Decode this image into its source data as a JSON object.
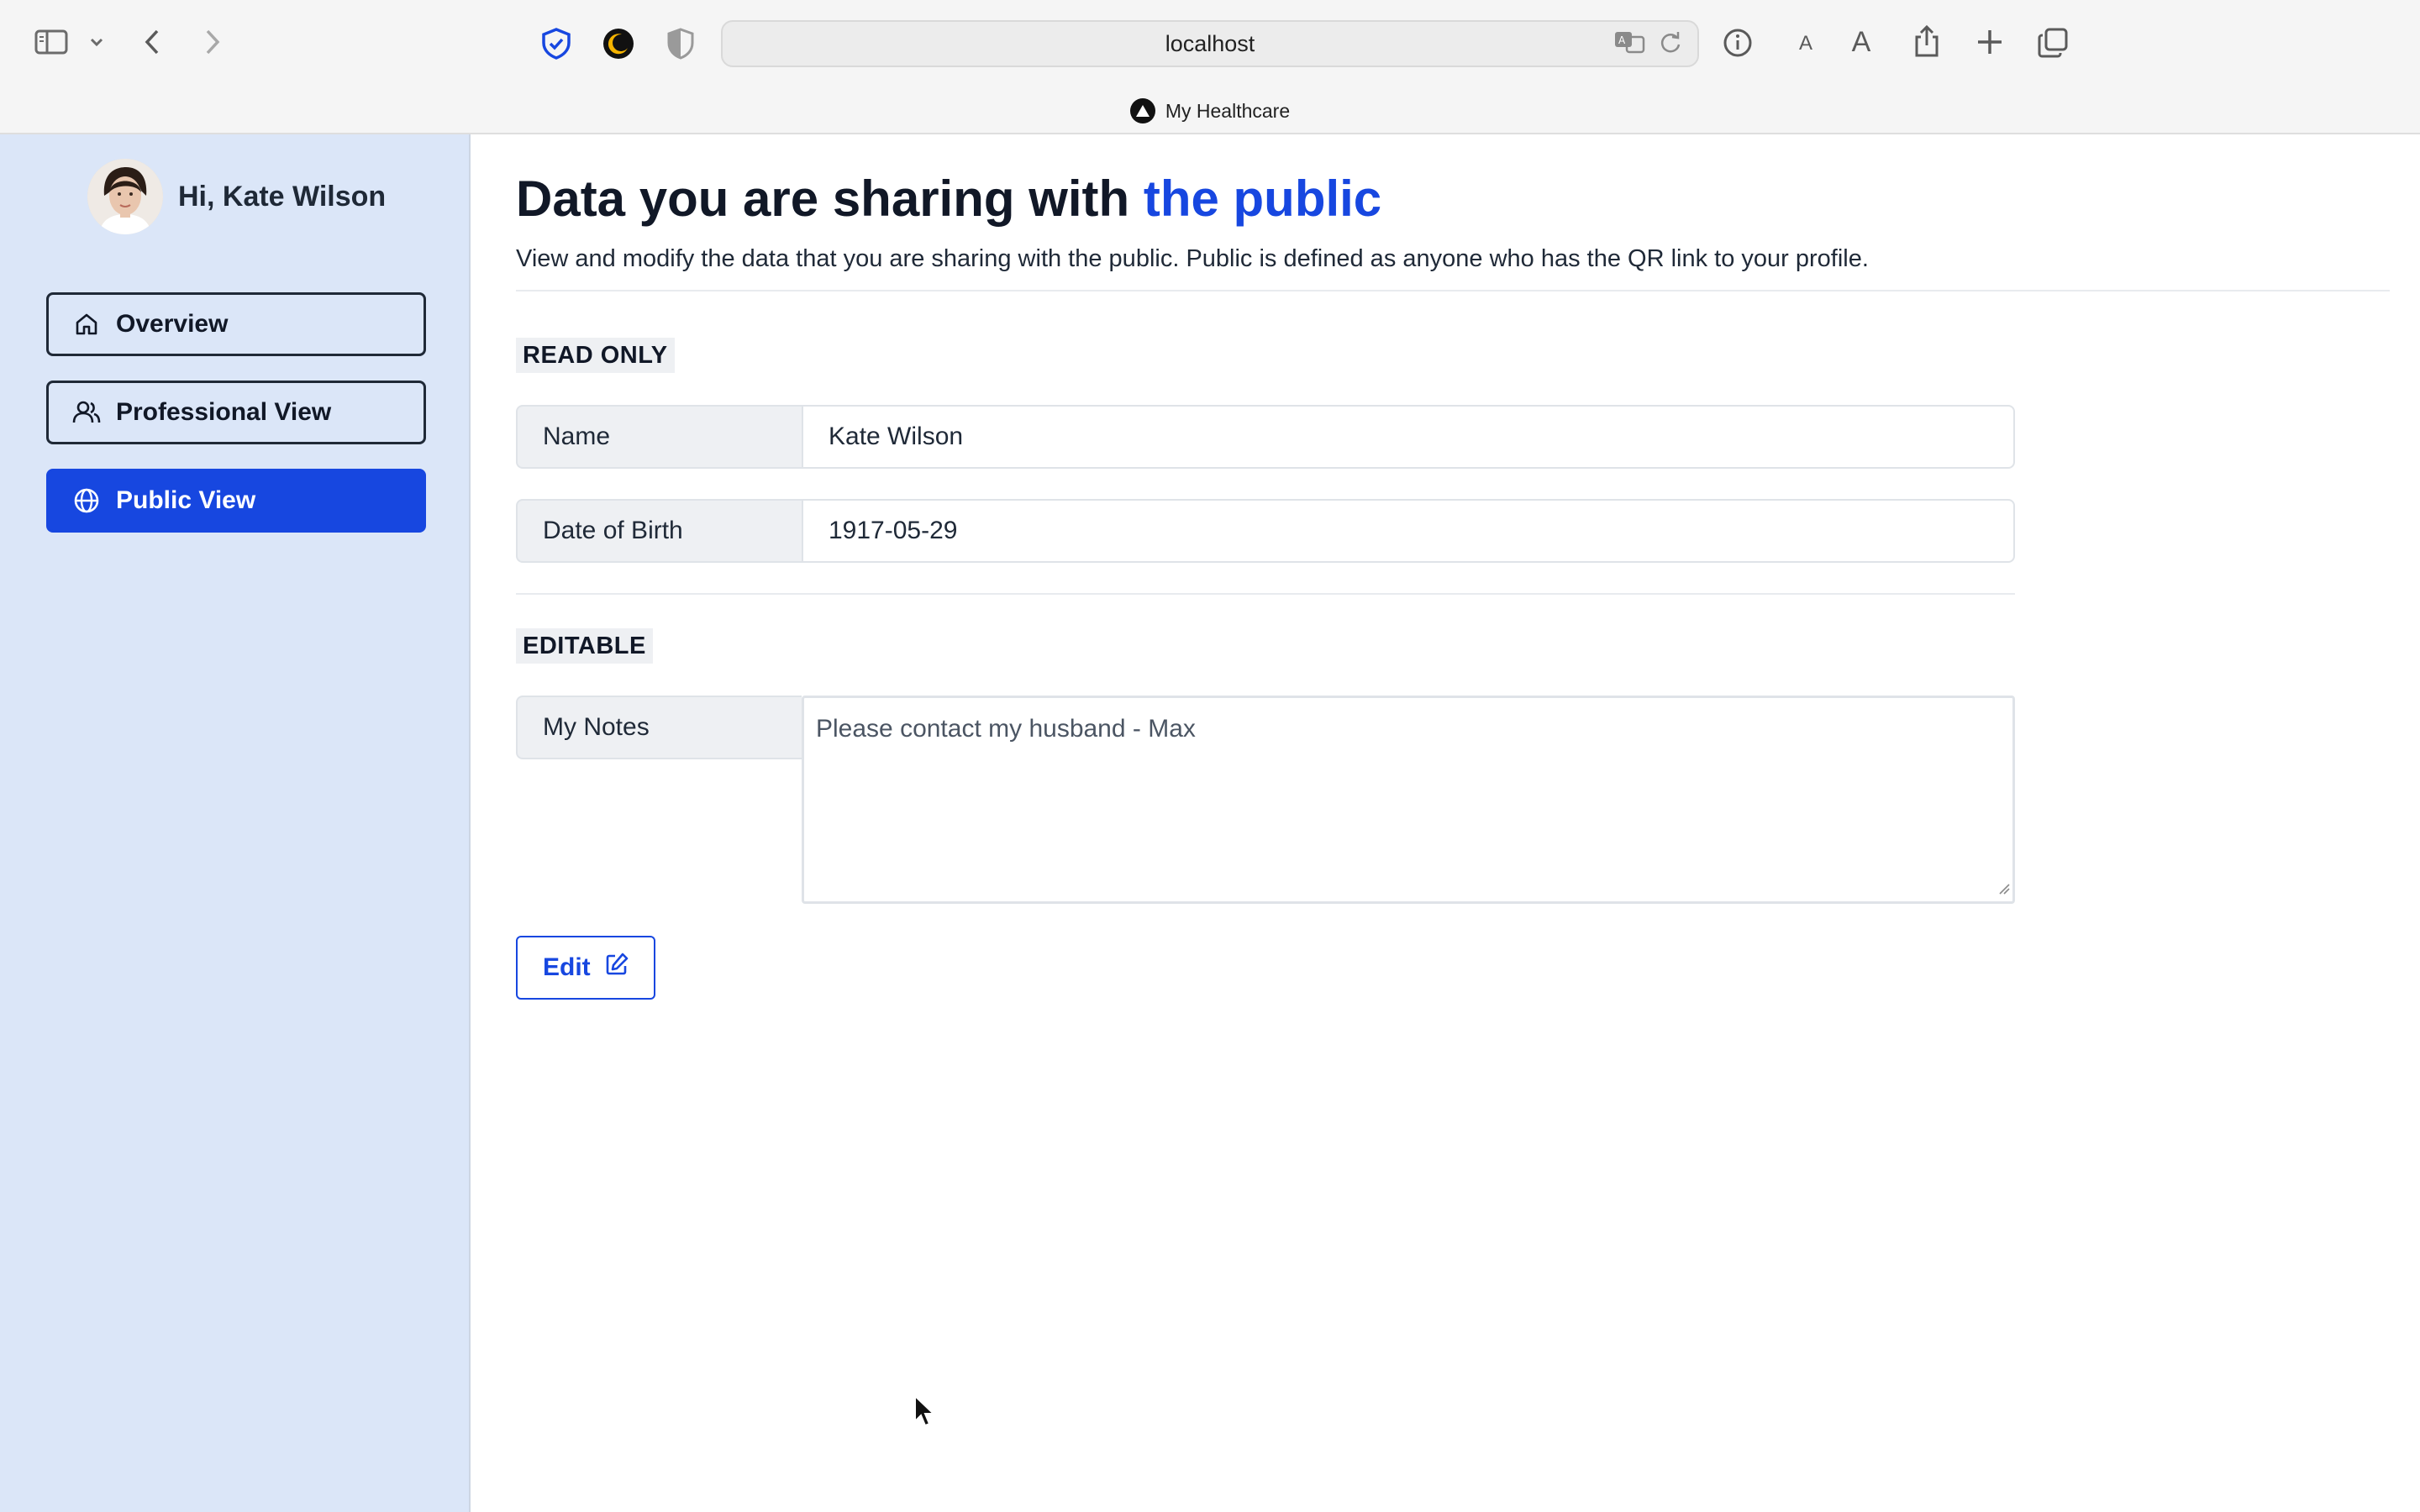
{
  "browser": {
    "url": "localhost",
    "tab_title": "My Healthcare",
    "icons": [
      "sidebar-toggle-icon",
      "chevron-down-icon",
      "back-arrow-icon",
      "forward-arrow-icon",
      "privacy-shield-icon",
      "dark-mode-icon",
      "content-blocker-icon",
      "translate-icon",
      "reload-icon",
      "info-icon",
      "text-smaller-icon",
      "text-larger-icon",
      "share-icon",
      "new-tab-icon",
      "tab-overview-icon"
    ],
    "text_small_label": "A",
    "text_large_label": "A"
  },
  "sidebar": {
    "greeting": "Hi, Kate Wilson",
    "items": [
      {
        "label": "Overview",
        "icon": "home-icon",
        "active": false
      },
      {
        "label": "Professional View",
        "icon": "users-icon",
        "active": false
      },
      {
        "label": "Public View",
        "icon": "globe-icon",
        "active": true
      }
    ]
  },
  "main": {
    "title_prefix": "Data you are sharing with ",
    "title_accent": "the public",
    "subtitle": "View and modify the data that you are sharing with the public. Public is defined as anyone who has the QR link to your profile.",
    "read_only": {
      "label": "READ ONLY",
      "fields": [
        {
          "label": "Name",
          "value": "Kate Wilson"
        },
        {
          "label": "Date of Birth",
          "value": "1917-05-29"
        }
      ]
    },
    "editable": {
      "label": "EDITABLE",
      "notes_label": "My Notes",
      "notes_value": "Please contact my husband - Max"
    },
    "edit_button": "Edit"
  },
  "colors": {
    "accent": "#1747e0",
    "sidebar_bg": "#dbe6f8",
    "text": "#1f2937"
  }
}
